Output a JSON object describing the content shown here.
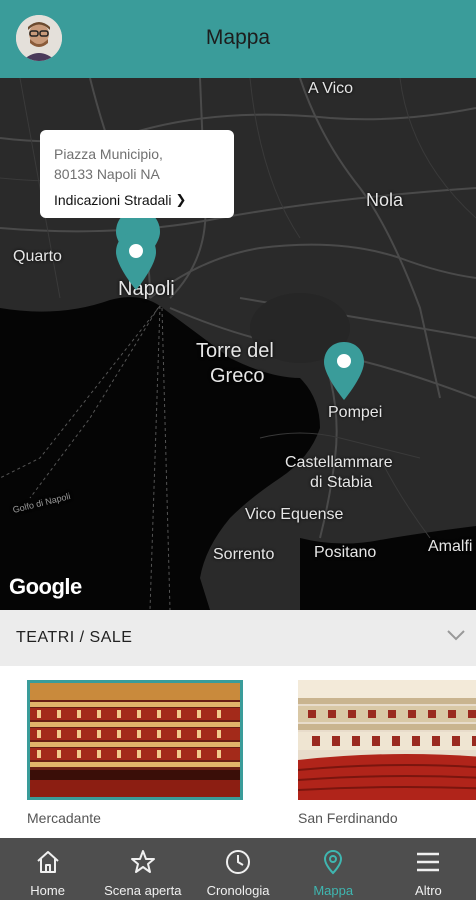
{
  "header": {
    "title": "Mappa"
  },
  "map": {
    "callout": {
      "address_line1": "Piazza Municipio,",
      "address_line2": "80133 Napoli NA",
      "directions_label": "Indicazioni Stradali",
      "chevron": "❯"
    },
    "places": {
      "a_vico": "A Vico",
      "nola": "Nola",
      "quarto": "Quarto",
      "napoli": "Napoli",
      "torre_del": "Torre del",
      "greco": "Greco",
      "pompei": "Pompei",
      "castellammare": "Castellammare",
      "di_stabia": "di Stabia",
      "vico_equense": "Vico Equense",
      "sorrento": "Sorrento",
      "positano": "Positano",
      "amalfi": "Amalfi",
      "golfo": "Golfo di Napoli"
    },
    "attribution": "Google",
    "pin_color": "#3a9c9a"
  },
  "section": {
    "title": "TEATRI / SALE",
    "cards": [
      {
        "label": "Mercadante"
      },
      {
        "label": "San Ferdinando"
      }
    ]
  },
  "nav": {
    "items": [
      {
        "label": "Home",
        "icon": "home-icon"
      },
      {
        "label": "Scena aperta",
        "icon": "star-icon"
      },
      {
        "label": "Cronologia",
        "icon": "clock-icon"
      },
      {
        "label": "Mappa",
        "icon": "map-pin-icon",
        "active": true
      },
      {
        "label": "Altro",
        "icon": "menu-icon"
      }
    ]
  },
  "colors": {
    "accent": "#3a9c9a",
    "nav_bg": "#4e4e4e",
    "active_nav": "#3fb6b0"
  }
}
